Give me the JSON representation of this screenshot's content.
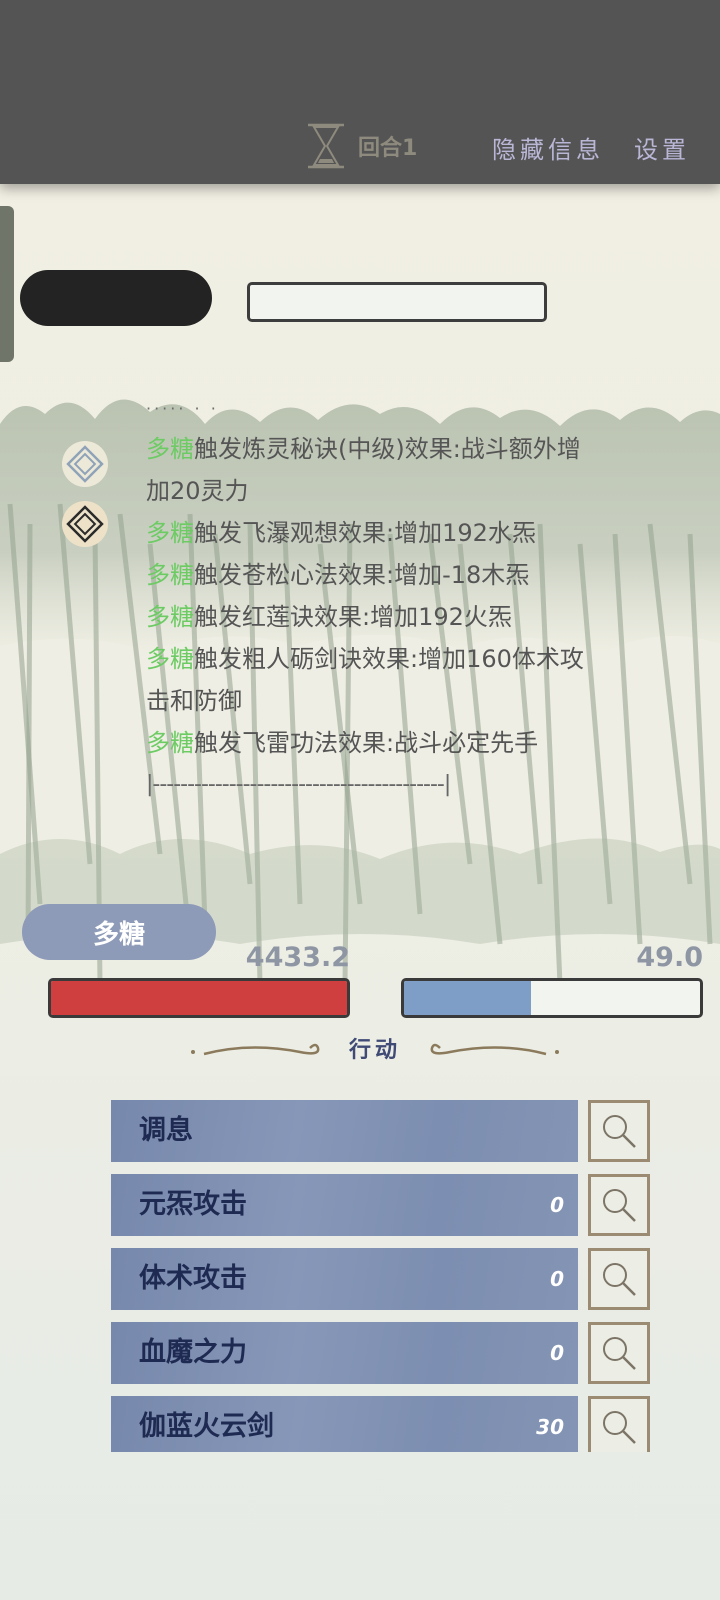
{
  "header": {
    "round_label": "回合1",
    "hide_info_label": "隐藏信息",
    "settings_label": "设置",
    "hourglass_icon": "hourglass-icon"
  },
  "enemy": {
    "name": ""
  },
  "battle_log": {
    "lines": [
      {
        "actor": "多糖",
        "text": "触发炼灵秘诀(中级)效果:战斗额外增"
      },
      {
        "actor": "",
        "text": "加20灵力"
      },
      {
        "actor": "多糖",
        "text": "触发飞瀑观想效果:增加192水炁"
      },
      {
        "actor": "多糖",
        "text": "触发苍松心法效果:增加-18木炁"
      },
      {
        "actor": "多糖",
        "text": "触发红莲诀效果:增加192火炁"
      },
      {
        "actor": "多糖",
        "text": "触发粗人砺剑诀效果:增加160体术攻"
      },
      {
        "actor": "",
        "text": "击和防御"
      },
      {
        "actor": "多糖",
        "text": "触发飞雷功法效果:战斗必定先手"
      }
    ],
    "divider": "|------------------------------------------|",
    "buff_icons": [
      "diamond-icon",
      "diamond-icon"
    ],
    "colors": {
      "actor": "#6ccb63",
      "text": "#555555"
    }
  },
  "player": {
    "name": "多糖",
    "hp_value": "4433.2",
    "mp_value": "49.0",
    "hp_fraction": 1.0,
    "mp_fraction": 0.43,
    "colors": {
      "hp": "#d03f3f",
      "mp": "#7f9ec7"
    }
  },
  "actions": {
    "title": "行动",
    "items": [
      {
        "name": "调息",
        "cost": ""
      },
      {
        "name": "元炁攻击",
        "cost": "0"
      },
      {
        "name": "体术攻击",
        "cost": "0"
      },
      {
        "name": "血魔之力",
        "cost": "0"
      },
      {
        "name": "伽蓝火云剑",
        "cost": "30"
      }
    ],
    "inspect_icon": "search-icon"
  }
}
